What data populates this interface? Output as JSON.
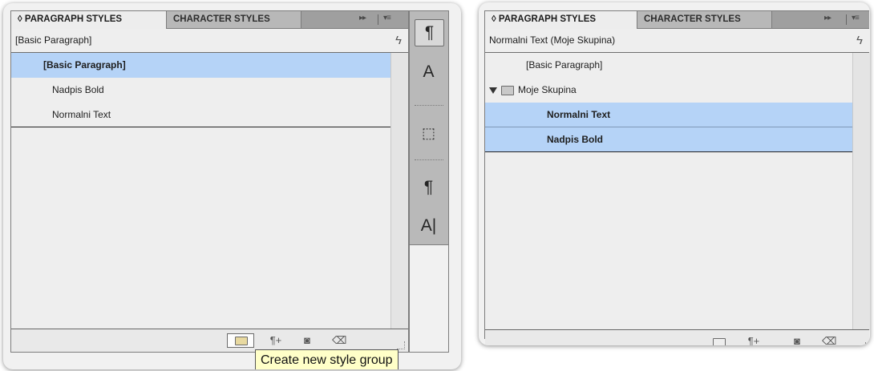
{
  "left": {
    "tab_active": "◊ PARAGRAPH STYLES",
    "tab_inactive": "CHARACTER STYLES",
    "tab_controls": "▸▸",
    "tab_menu": "▾≡",
    "current_style": "[Basic Paragraph]",
    "styles": [
      "[Basic Paragraph]",
      "Nadpis Bold",
      "Normalni Text"
    ],
    "selected_index": 0,
    "footer_icons": [
      "folder-icon",
      "new-style-override-icon",
      "new-style-icon",
      "trash-icon"
    ],
    "tooltip": "Create new style group"
  },
  "dock": {
    "buttons": [
      {
        "icon": "paragraph-styles-icon",
        "glyph": "¶",
        "active": true
      },
      {
        "icon": "character-styles-icon",
        "glyph": "A",
        "active": false
      },
      {
        "icon": "object-styles-icon",
        "glyph": "⬚",
        "active": false
      },
      {
        "icon": "paragraph-icon",
        "glyph": "¶",
        "active": false
      },
      {
        "icon": "character-icon",
        "glyph": "A|",
        "active": false
      }
    ]
  },
  "right": {
    "tab_active": "◊ PARAGRAPH STYLES",
    "tab_inactive": "CHARACTER STYLES",
    "tab_controls": "▸▸",
    "tab_menu": "▾≡",
    "current_style": "Normalni Text (Moje Skupina)",
    "basic": "[Basic Paragraph]",
    "group_name": "Moje Skupina",
    "group_items": [
      "Normalni Text",
      "Nadpis Bold"
    ],
    "footer_icons": [
      "folder-icon",
      "new-style-override-icon",
      "new-style-icon",
      "trash-icon"
    ]
  },
  "colors": {
    "selection": "#b5d3f7",
    "tooltip_bg": "#ffffc8",
    "tab_bar": "#9f9f9f"
  }
}
